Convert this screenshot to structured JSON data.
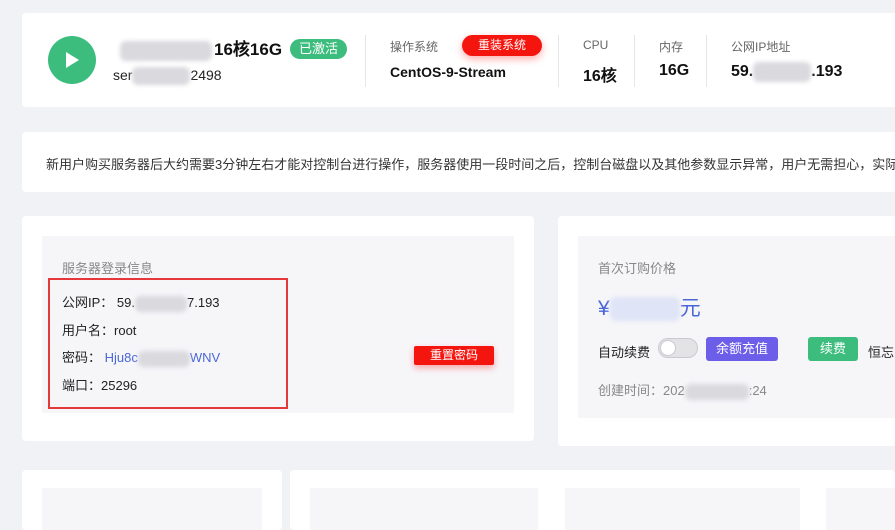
{
  "header": {
    "server_name_suffix": "16核16G",
    "status": "已激活",
    "server_id_prefix": "ser",
    "server_id_suffix": "2498",
    "os": {
      "label": "操作系统",
      "value": "CentOS-9-Stream",
      "reinstall_button": "重装系统"
    },
    "cpu": {
      "label": "CPU",
      "value": "16核"
    },
    "memory": {
      "label": "内存",
      "value": "16G"
    },
    "public_ip": {
      "label": "公网IP地址",
      "prefix": "59.",
      "suffix": ".193"
    }
  },
  "notice": {
    "text": "新用户购买服务器后大约需要3分钟左右才能对控制台进行操作，服务器使用一段时间之后，控制台磁盘以及其他参数显示异常，用户无需担心，实际"
  },
  "login_info": {
    "title": "服务器登录信息",
    "ip_label": "公网IP：",
    "ip_prefix": "59.",
    "ip_suffix": "7.193",
    "username_label": "用户名：",
    "username": "root",
    "password_label": "密码：",
    "password_prefix": "Hju8c",
    "password_suffix": "WNV",
    "port_label": "端口：",
    "port": "25296",
    "reset_password_button": "重置密码"
  },
  "price": {
    "title": "首次订购价格",
    "currency_symbol": "¥",
    "unit": "元",
    "auto_renew_label": "自动续费",
    "auto_renew_enabled": false,
    "recharge_button": "余额充值",
    "renew_button": "续费",
    "cut_text": "恒忘",
    "created_label": "创建时间：",
    "created_prefix": "202",
    "created_suffix": ":24"
  },
  "colors": {
    "green": "#3dbd7d",
    "red": "#f5150f",
    "purple": "#6c5ee8",
    "link_blue": "#4a67d8",
    "highlight_red": "#e5383b",
    "page_bg": "#f1f2f5"
  }
}
